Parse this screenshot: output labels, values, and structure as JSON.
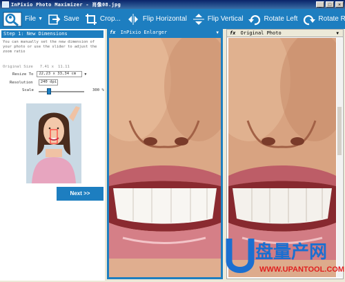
{
  "window": {
    "title": "InPixio Photo Maximizer - 肖像08.jpg"
  },
  "toolbar": {
    "file": "File",
    "save": "Save",
    "crop": "Crop...",
    "flip_h": "Flip Horizontal",
    "flip_v": "Flip Vertical",
    "rotate_left": "Rotate Left",
    "rotate_right": "Rotate Right"
  },
  "left_panel": {
    "step_title": "Step 1: New Dimensions",
    "description": "You can manually set the new dimension of your photo or use the slider to adjust the zoom ratio",
    "original_size_label": "Original Size",
    "original_w": "7.41 x",
    "original_h": "11.11",
    "resize_label": "Resize To",
    "resize_value": "22,23 x 33,34 cm",
    "resolution_label": "Resolution",
    "resolution_value": "240 dpi",
    "scale_label": "Scale",
    "scale_value": "300 %",
    "scale_fraction": 0.2,
    "next_label": "Next >>"
  },
  "panels": {
    "enlarger_title": "InPixio Enlarger",
    "original_title": "Original Photo",
    "fx": "fx"
  },
  "watermark": {
    "brand": "盘量产网",
    "url": "WWW.UPANTOOL.COM"
  },
  "colors": {
    "accent": "#1d7ec0"
  }
}
